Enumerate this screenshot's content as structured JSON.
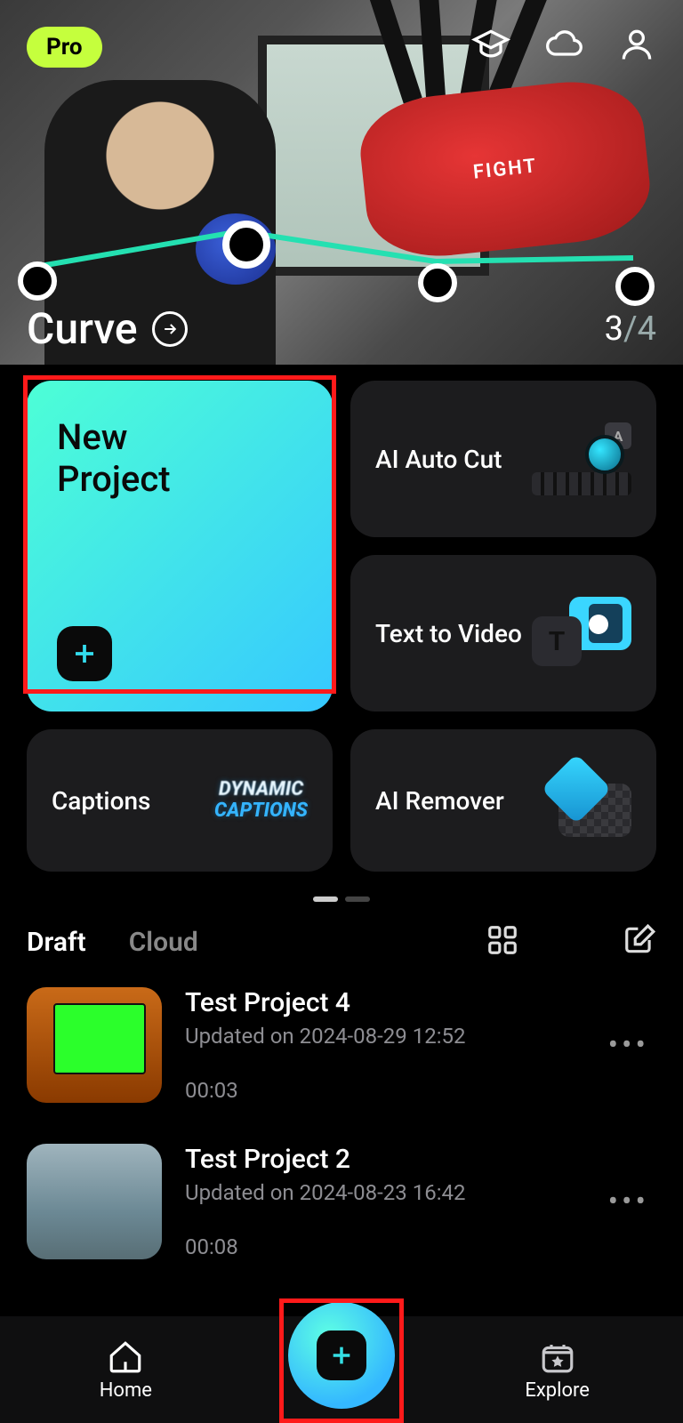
{
  "pro_badge": "Pro",
  "hero": {
    "feature_title": "Curve",
    "bag_label": "FIGHT",
    "page_current": "3",
    "page_total": "/4"
  },
  "tiles": {
    "new_project": "New\nProject",
    "ai_auto_cut": "AI Auto Cut",
    "text_to_video": "Text to Video",
    "captions": "Captions",
    "captions_tag_l1": "DYNAMIC",
    "captions_tag_l2": "CAPTIONS",
    "ai_remover": "AI Remover"
  },
  "tabs": {
    "draft": "Draft",
    "cloud": "Cloud"
  },
  "projects": [
    {
      "title": "Test Project 4",
      "updated": "Updated on 2024-08-29 12:52",
      "duration": "00:03"
    },
    {
      "title": "Test Project 2",
      "updated": "Updated on 2024-08-23 16:42",
      "duration": "00:08"
    }
  ],
  "nav": {
    "home": "Home",
    "explore": "Explore"
  }
}
